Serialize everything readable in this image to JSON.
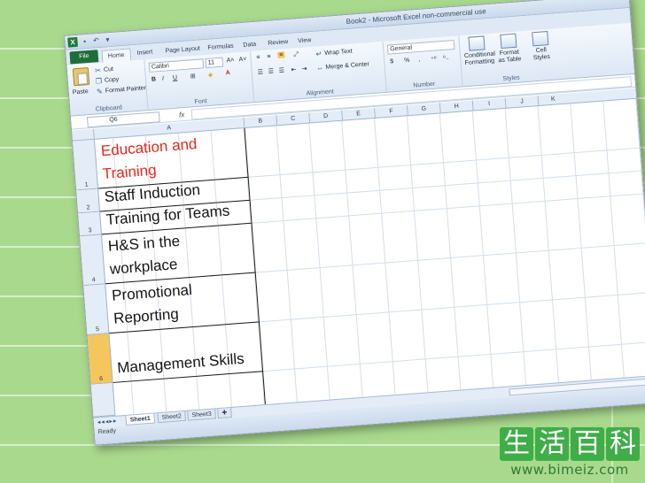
{
  "window": {
    "title": "Book2 - Microsoft Excel non-commercial use"
  },
  "ribbon_tabs": [
    "File",
    "Home",
    "Insert",
    "Page Layout",
    "Formulas",
    "Data",
    "Review",
    "View"
  ],
  "clipboard": {
    "paste": "Paste",
    "cut": "Cut",
    "copy": "Copy",
    "format_painter": "Format Painter",
    "label": "Clipboard"
  },
  "font": {
    "name": "Calibri",
    "size": "11",
    "bold": "B",
    "italic": "I",
    "underline": "U",
    "grow": "A˄",
    "shrink": "A˅",
    "color_glyph": "A",
    "label": "Font"
  },
  "alignment": {
    "wrap_text": "Wrap Text",
    "merge_center": "Merge & Center",
    "label": "Alignment"
  },
  "number": {
    "format": "General",
    "currency": "$",
    "percent": "%",
    "comma": ",",
    "label": "Number"
  },
  "styles": {
    "conditional": "Conditional Formatting",
    "format_table": "Format as Table",
    "cell_styles": "Cell Styles",
    "label": "Styles"
  },
  "formula_bar": {
    "name_box": "Q6",
    "fx": "fx",
    "value": ""
  },
  "grid": {
    "columns": [
      "A",
      "B",
      "C",
      "D",
      "E",
      "F",
      "G",
      "H",
      "I",
      "J",
      "K"
    ],
    "rows": [
      {
        "num": "1",
        "text": "Education and\nTraining",
        "color": "#e8261c"
      },
      {
        "num": "2",
        "text": "Staff Induction",
        "color": "#141414"
      },
      {
        "num": "3",
        "text": "Training for Teams",
        "color": "#141414"
      },
      {
        "num": "4",
        "text": "H&S in the\nworkplace",
        "color": "#141414"
      },
      {
        "num": "5",
        "text": " Promotional\n Reporting",
        "color": "#141414"
      },
      {
        "num": "6",
        "text": "  Management Skills",
        "color": "#141414"
      }
    ],
    "selected_row_color": "#f5c65b"
  },
  "sheets": [
    "Sheet1",
    "Sheet2",
    "Sheet3"
  ],
  "status": "Ready",
  "watermark": {
    "logo_chars": [
      "生",
      "活",
      "百",
      "科"
    ],
    "url": "www.bimeiz.com"
  }
}
